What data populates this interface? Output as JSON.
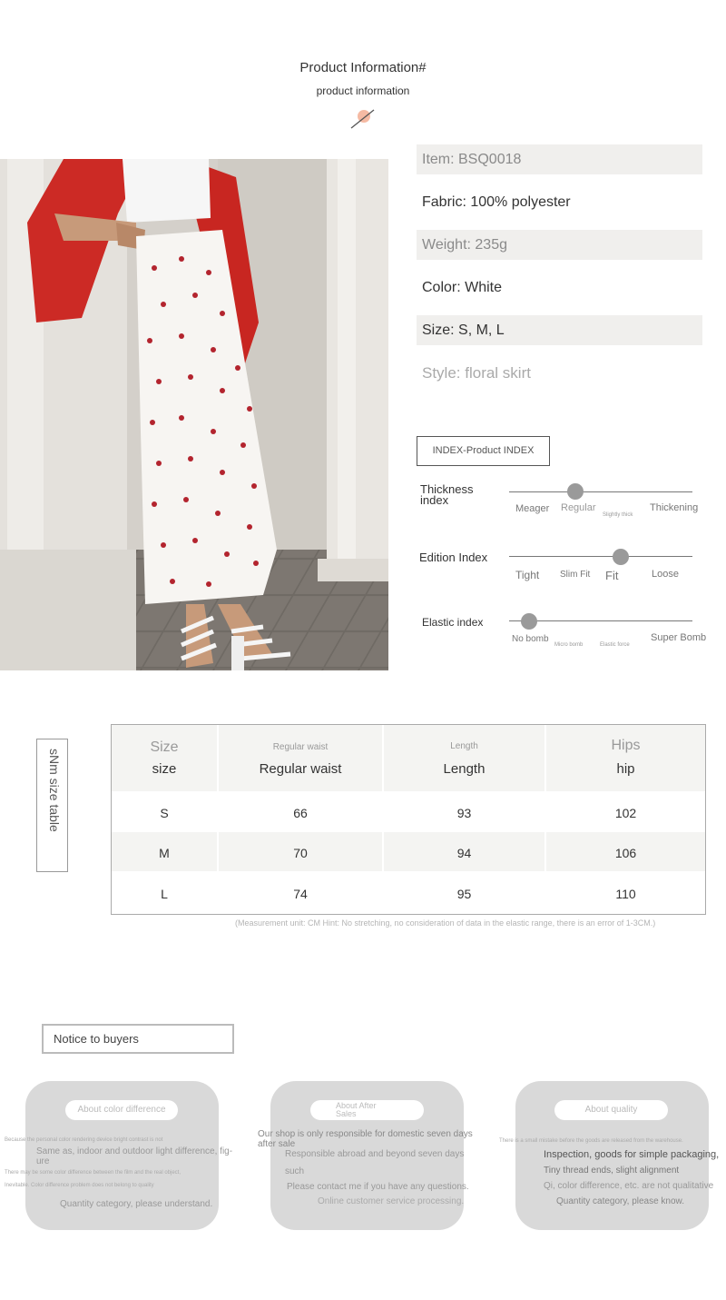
{
  "header": {
    "title": "Product Information#",
    "subtitle": "product  information"
  },
  "specs": [
    {
      "text": "Item: BSQ0018"
    },
    {
      "text": "Fabric: 100% polyester"
    },
    {
      "text": "Weight: 235g"
    },
    {
      "text": "Color: White"
    },
    {
      "text": "Size: S, M, L"
    },
    {
      "text": "Style: floral skirt"
    }
  ],
  "index": {
    "title": "INDEX-Product INDEX",
    "thickness": {
      "label_line1": "Thickness",
      "label_line2": "index",
      "ticks": [
        "Meager",
        "Regular",
        "Thickening"
      ],
      "small_tick": "Slightly thick",
      "level": 0.33
    },
    "edition": {
      "label": "Edition Index",
      "ticks": [
        "Tight",
        "Slim Fit",
        "Fit",
        "Loose"
      ],
      "level": 0.62
    },
    "elastic": {
      "label": "Elastic index",
      "ticks": [
        "No bomb",
        "Super Bomb"
      ],
      "small_ticks": [
        "Micro bomb",
        "Elastic force"
      ],
      "level": 0.1
    }
  },
  "size_table": {
    "side_label": "sNm size table",
    "headers": [
      {
        "top": "Size",
        "main": "size"
      },
      {
        "top": "Regular waist",
        "main": "Regular waist"
      },
      {
        "top": "Length",
        "main": "Length"
      },
      {
        "top": "Hips",
        "main": "hip"
      }
    ],
    "rows": [
      [
        "S",
        "66",
        "93",
        "102"
      ],
      [
        "M",
        "70",
        "94",
        "106"
      ],
      [
        "L",
        "74",
        "95",
        "110"
      ]
    ],
    "note": "(Measurement unit: CM Hint: No stretching, no consideration of data in the elastic range, there is an error of 1-3CM.)"
  },
  "notice": {
    "title": "Notice to buyers",
    "cards": [
      {
        "pill": "About color difference",
        "lines": [
          "Because the personal color rendering device bright contrast is not",
          "Same as, indoor and outdoor light difference, fig-",
          "ure",
          "There may be some color difference between the film and the real object,",
          "Inevitable. Color difference problem does not belong to quality",
          "Quantity category, please understand."
        ]
      },
      {
        "pill_line1": "About After",
        "pill_line2": "Sales",
        "lines": [
          "Our shop is only responsible for domestic seven days",
          "after sale",
          "Responsible abroad and beyond seven days",
          "such",
          "Please contact me if you have any questions.",
          "Online customer service processing."
        ]
      },
      {
        "pill": "About quality",
        "lines": [
          "There is a small mistake before the goods are released from the warehouse.",
          "Inspection, goods for simple packaging,",
          "Tiny thread ends, slight alignment",
          "Qi, color difference, etc. are not qualitative",
          "Quantity category, please know."
        ]
      }
    ]
  }
}
